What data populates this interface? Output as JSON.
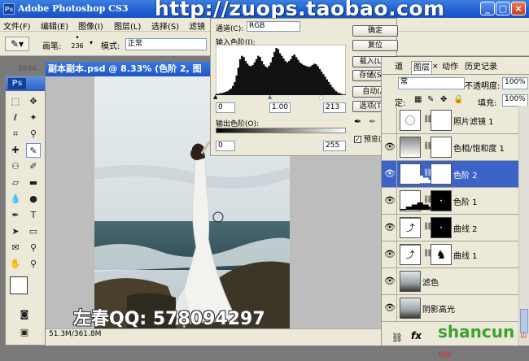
{
  "app": {
    "title": "Adobe Photoshop CS3",
    "ps_icon": "Ps",
    "watermark_top": "http://zuops.taobao.com",
    "watermark_bottom": "左春QQ: 578094297",
    "site_logo": "shancun",
    "site_logo_sub": "山村网"
  },
  "window_controls": {
    "minimize": "_",
    "maximize": "□",
    "close": "×"
  },
  "menu": [
    "文件(F)",
    "编辑(E)",
    "图像(I)",
    "图层(L)",
    "选择(S)",
    "滤镜"
  ],
  "options": {
    "brush_label": "画笔:",
    "brush_size": "236",
    "mode_label": "模式:",
    "mode_value": "正常"
  },
  "toolbox": {
    "logo": "Ps"
  },
  "document": {
    "title": "副本副本.psd @ 8.33% (色阶 2, 图",
    "status": "51.3M/361.8M",
    "ruler_value": "5894"
  },
  "levels": {
    "channel_label": "通道(C):",
    "channel_value": "RGB",
    "input_label": "输入色阶(I):",
    "input_values": [
      "0",
      "1.00",
      "213"
    ],
    "output_label": "输出色阶(O):",
    "output_values": [
      "0",
      "255"
    ],
    "buttons": [
      "确定",
      "复位",
      "载入(L)...",
      "存储(S)...",
      "自动(A)",
      "选项(T)..."
    ],
    "preview_label": "预览(P)",
    "preview_checked": true,
    "histogram": [
      2,
      2,
      3,
      3,
      4,
      5,
      6,
      8,
      10,
      14,
      20,
      30,
      42,
      55,
      60,
      58,
      52,
      48,
      45,
      44,
      46,
      50,
      55,
      60,
      58,
      52,
      47,
      44,
      42,
      45,
      50,
      58,
      66,
      72,
      70,
      64,
      60,
      56,
      52,
      50,
      52,
      55,
      60,
      62,
      58,
      54,
      50,
      48,
      46,
      45,
      44,
      43,
      44,
      46,
      48,
      47,
      44,
      40,
      36,
      32,
      28,
      24,
      20,
      16,
      12,
      9,
      6,
      4,
      3,
      2,
      1,
      1
    ]
  },
  "layers_panel": {
    "tabs": [
      "道",
      "图层",
      "动作",
      "历史记录"
    ],
    "close_icon": "×",
    "blend_mode": "常",
    "opacity_label": "不透明度:",
    "opacity_value": "100%",
    "lock_label": "定:",
    "fill_label": "填充:",
    "fill_value": "100%",
    "layers": [
      {
        "name": "照片滤镜 1",
        "visible": false,
        "selected": false,
        "kind": "filter",
        "mask": "white"
      },
      {
        "name": "色相/饱和度 1",
        "visible": true,
        "selected": false,
        "kind": "hue",
        "mask": "white"
      },
      {
        "name": "色阶 2",
        "visible": true,
        "selected": true,
        "kind": "levels",
        "mask": "white"
      },
      {
        "name": "色阶 1",
        "visible": true,
        "selected": false,
        "kind": "levels",
        "mask": "black"
      },
      {
        "name": "曲线 2",
        "visible": true,
        "selected": false,
        "kind": "curves",
        "mask": "black"
      },
      {
        "name": "曲线 1",
        "visible": true,
        "selected": false,
        "kind": "curves",
        "mask": "figure"
      },
      {
        "name": "滤色",
        "visible": true,
        "selected": false,
        "kind": "image",
        "mask": ""
      },
      {
        "name": "阴影高光",
        "visible": true,
        "selected": false,
        "kind": "image",
        "mask": ""
      }
    ],
    "bottom_icons": [
      "link-icon",
      "fx-icon"
    ]
  }
}
